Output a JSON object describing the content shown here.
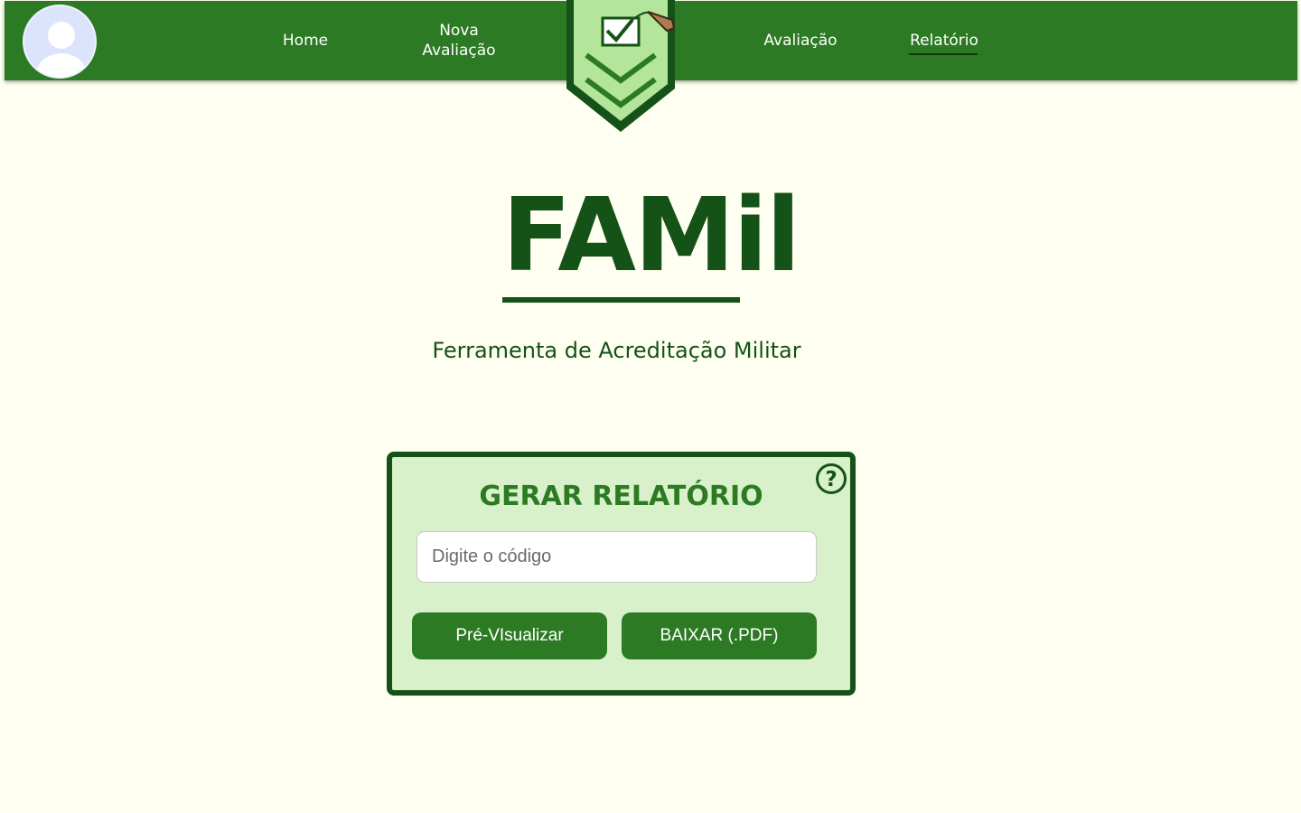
{
  "nav": {
    "items": [
      {
        "label": "Home"
      },
      {
        "label": "Nova Avaliação"
      },
      {
        "label": "Avaliação"
      },
      {
        "label": "Relatório",
        "active": true
      }
    ]
  },
  "header": {
    "brand": "FAMil",
    "subtitle": "Ferramenta de Acreditação Militar"
  },
  "report_card": {
    "title": "GERAR RELATÓRIO",
    "help_icon": "question-circle-icon",
    "code_input": {
      "placeholder": "Digite o código",
      "value": ""
    },
    "preview_label": "Pré-VIsualizar",
    "download_label": "BAIXAR (.PDF)"
  },
  "colors": {
    "background": "#fefff0",
    "nav_green": "#2d7a24",
    "dark_green": "#155217",
    "card_background": "#d8f1cb",
    "badge_light_green": "#b3e69a"
  }
}
